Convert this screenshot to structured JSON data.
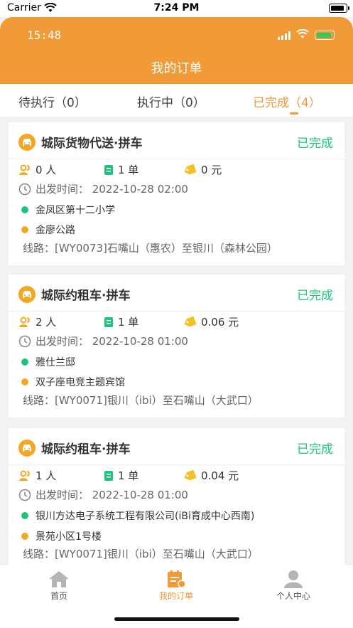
{
  "ios_status": {
    "carrier": "Carrier",
    "time": "7:24 PM"
  },
  "inner_status": {
    "time": "15:48"
  },
  "header": {
    "title": "我的订单"
  },
  "tabs": [
    {
      "label": "待执行（0）",
      "active": false
    },
    {
      "label": "执行中（0）",
      "active": false
    },
    {
      "label": "已完成（4）",
      "active": true
    }
  ],
  "orders": [
    {
      "title": "城际货物代送·拼车",
      "status": "已完成",
      "people": "0 人",
      "count": "1 单",
      "price": "0 元",
      "depart": "出发时间：  2022-10-28 02:00",
      "start": "金凤区第十二小学",
      "end": "金廖公路",
      "route": "线路：[WY0073]石嘴山（惠农）至银川（森林公园）"
    },
    {
      "title": "城际约租车·拼车",
      "status": "已完成",
      "people": "2 人",
      "count": "1 单",
      "price": "0.06 元",
      "depart": "出发时间：  2022-10-28 01:00",
      "start": "雅仕兰邸",
      "end": "双子座电竞主题宾馆",
      "route": "线路：[WY0071]银川（ibi）至石嘴山（大武口）"
    },
    {
      "title": "城际约租车·拼车",
      "status": "已完成",
      "people": "1 人",
      "count": "1 单",
      "price": "0.04 元",
      "depart": "出发时间：  2022-10-28 01:00",
      "start": "银川方达电子系统工程有限公司(iBi育成中心西南)",
      "end": "景苑小区1号楼",
      "route": "线路：[WY0071]银川（ibi）至石嘴山（大武口）"
    }
  ],
  "bottom_nav": [
    {
      "label": "首页",
      "icon": "home-icon",
      "active": false
    },
    {
      "label": "我的订单",
      "icon": "orders-icon",
      "active": true
    },
    {
      "label": "个人中心",
      "icon": "user-center-icon",
      "active": false
    }
  ],
  "colors": {
    "accent": "#f19a38",
    "completed": "#1fc47c",
    "start_dot": "#1fc47c",
    "end_dot": "#f5a623"
  }
}
